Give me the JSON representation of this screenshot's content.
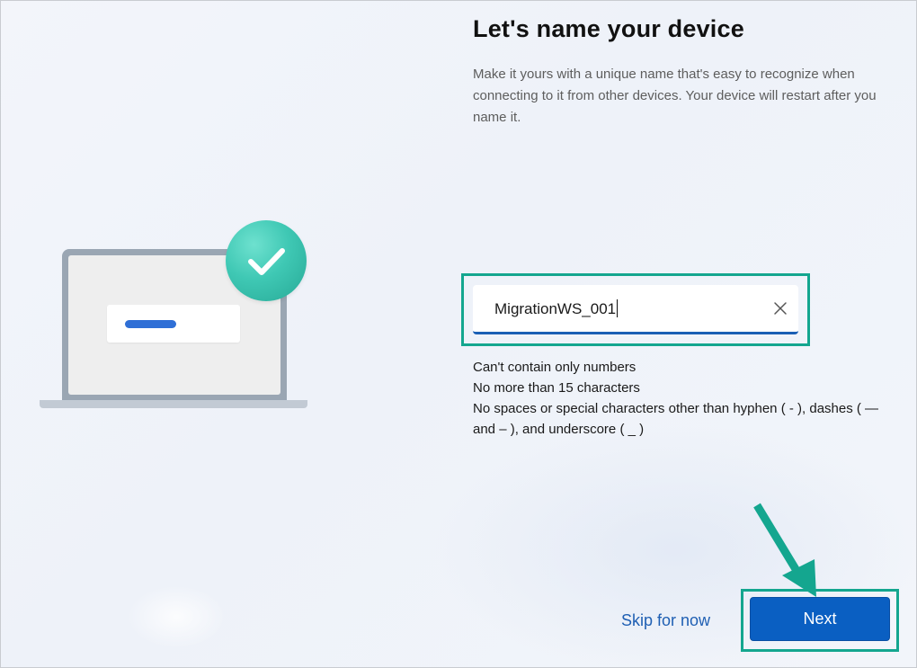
{
  "title": "Let's name your device",
  "description": "Make it yours with a unique name that's easy to recognize when connecting to it from other devices. Your device will restart after you name it.",
  "name_input": {
    "value": "MigrationWS_001",
    "clear_icon": "close-icon"
  },
  "rules": [
    "Can't contain only numbers",
    "No more than 15 characters",
    "No spaces or special characters other than hyphen ( - ), dashes ( — and – ), and underscore ( _ )"
  ],
  "actions": {
    "skip_label": "Skip for now",
    "next_label": "Next"
  },
  "colors": {
    "accent": "#0a5fc2",
    "highlight": "#14a68f",
    "check": "#3fc8b4",
    "link": "#1f5fb3"
  },
  "illustration": {
    "icons": [
      "laptop-icon",
      "checkmark-icon"
    ]
  },
  "annotation": {
    "arrow_icon": "arrow-icon"
  }
}
